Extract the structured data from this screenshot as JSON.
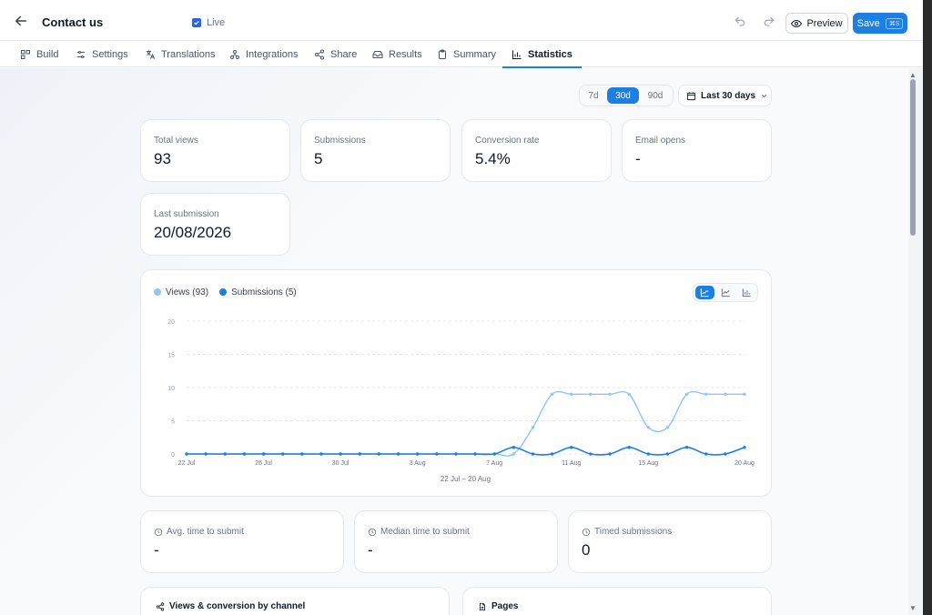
{
  "header": {
    "title": "Contact us",
    "live_label": "Live",
    "preview_label": "Preview",
    "save_label": "Save",
    "save_shortcut": "⌘S"
  },
  "tabs": [
    {
      "label": "Build",
      "icon": "blocks-icon"
    },
    {
      "label": "Settings",
      "icon": "sliders-icon"
    },
    {
      "label": "Translations",
      "icon": "translate-icon"
    },
    {
      "label": "Integrations",
      "icon": "plug-icon"
    },
    {
      "label": "Share",
      "icon": "share-icon"
    },
    {
      "label": "Results",
      "icon": "inbox-icon"
    },
    {
      "label": "Summary",
      "icon": "clipboard-icon"
    },
    {
      "label": "Statistics",
      "icon": "bar-chart-icon",
      "active": true
    }
  ],
  "range": {
    "options": [
      "7d",
      "30d",
      "90d"
    ],
    "selected": "30d",
    "date_label": "Last 30 days"
  },
  "stats": {
    "total_views": {
      "label": "Total views",
      "value": "93"
    },
    "submissions": {
      "label": "Submissions",
      "value": "5"
    },
    "conversion_rate": {
      "label": "Conversion rate",
      "value": "5.4%"
    },
    "email_opens": {
      "label": "Email opens",
      "value": "-"
    },
    "last_submission": {
      "label": "Last submission",
      "value": "20/08/2026"
    }
  },
  "chart_data": {
    "type": "line",
    "legend": [
      "Views (93)",
      "Submissions (5)"
    ],
    "ylim": [
      0,
      20
    ],
    "yticks": [
      "20",
      "15",
      "10",
      "5",
      "0"
    ],
    "xtick_labels": [
      "22 Jul",
      "26 Jul",
      "30 Jul",
      "3 Aug",
      "7 Aug",
      "11 Aug",
      "15 Aug",
      "20 Aug"
    ],
    "xlabel": "22 Jul – 20 Aug",
    "x": [
      "22 Jul",
      "23 Jul",
      "24 Jul",
      "25 Jul",
      "26 Jul",
      "27 Jul",
      "28 Jul",
      "29 Jul",
      "30 Jul",
      "31 Jul",
      "1 Aug",
      "2 Aug",
      "3 Aug",
      "4 Aug",
      "5 Aug",
      "6 Aug",
      "7 Aug",
      "8 Aug",
      "9 Aug",
      "10 Aug",
      "11 Aug",
      "12 Aug",
      "13 Aug",
      "14 Aug",
      "15 Aug",
      "16 Aug",
      "17 Aug",
      "18 Aug",
      "19 Aug",
      "20 Aug"
    ],
    "series": [
      {
        "name": "Views (93)",
        "color": "#93c5f3",
        "values": [
          0,
          0,
          0,
          0,
          0,
          0,
          0,
          0,
          0,
          0,
          0,
          0,
          0,
          0,
          0,
          0,
          0,
          0,
          4,
          9,
          9,
          9,
          9,
          9,
          4,
          4,
          9,
          9,
          9,
          9
        ]
      },
      {
        "name": "Submissions (5)",
        "color": "#1d7fe0",
        "values": [
          0,
          0,
          0,
          0,
          0,
          0,
          0,
          0,
          0,
          0,
          0,
          0,
          0,
          0,
          0,
          0,
          0,
          1,
          0,
          0,
          1,
          0,
          0,
          1,
          0,
          0,
          1,
          0,
          0,
          1
        ]
      }
    ],
    "grid": true
  },
  "timing": {
    "avg": {
      "label": "Avg. time to submit",
      "value": "-"
    },
    "median": {
      "label": "Median time to submit",
      "value": "-"
    },
    "timed": {
      "label": "Timed submissions",
      "value": "0"
    }
  },
  "sections": {
    "channel": "Views & conversion by channel",
    "pages": "Pages"
  },
  "colors": {
    "accent": "#1d7fe0",
    "views": "#93c5f3"
  }
}
